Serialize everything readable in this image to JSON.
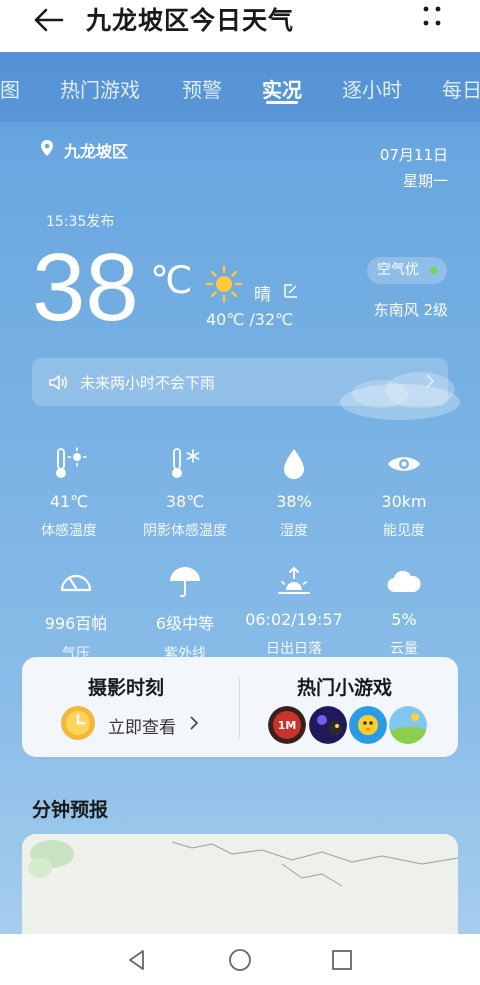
{
  "header": {
    "title": "九龙坡区今日天气",
    "back_icon": "back-arrow-icon",
    "menu_icon": "more-vertical-icon"
  },
  "tabs": [
    {
      "label": "图"
    },
    {
      "label": "热门游戏"
    },
    {
      "label": "预警"
    },
    {
      "label": "实况",
      "active": true
    },
    {
      "label": "逐小时"
    },
    {
      "label": "每日"
    }
  ],
  "location": {
    "name": "九龙坡区",
    "date": "07月11日",
    "weekday": "星期一"
  },
  "published": "15:35发布",
  "current": {
    "temperature": "38",
    "unit": "℃",
    "condition": "晴",
    "range": "40℃ /32℃",
    "air_quality": "空气优",
    "wind": "东南风 2级"
  },
  "alert": {
    "text": "未来两小时不会下雨"
  },
  "metrics": [
    {
      "value": "41℃",
      "label": "体感温度",
      "icon": "feels-like-thermometer-icon"
    },
    {
      "value": "38℃",
      "label": "阴影体感温度",
      "icon": "shade-thermometer-icon"
    },
    {
      "value": "38%",
      "label": "湿度",
      "icon": "humidity-drop-icon"
    },
    {
      "value": "30km",
      "label": "能见度",
      "icon": "visibility-eye-icon"
    },
    {
      "value": "996百帕",
      "label": "气压",
      "icon": "pressure-gauge-icon"
    },
    {
      "value": "6级中等",
      "label": "紫外线",
      "icon": "uv-umbrella-icon"
    },
    {
      "value": "06:02/19:57",
      "label": "日出日落",
      "icon": "sunrise-icon"
    },
    {
      "value": "5%",
      "label": "云量",
      "icon": "cloud-icon"
    }
  ],
  "cards": {
    "photo": {
      "title": "摄影时刻",
      "action": "立即查看"
    },
    "games": {
      "title": "热门小游戏"
    }
  },
  "minute_forecast": {
    "title": "分钟预报"
  },
  "colors": {
    "sky_top": "#5a9ad9",
    "sky_bottom": "#a6cdee",
    "sun": "#ffc93a",
    "aq_dot": "#6cdc4a"
  }
}
